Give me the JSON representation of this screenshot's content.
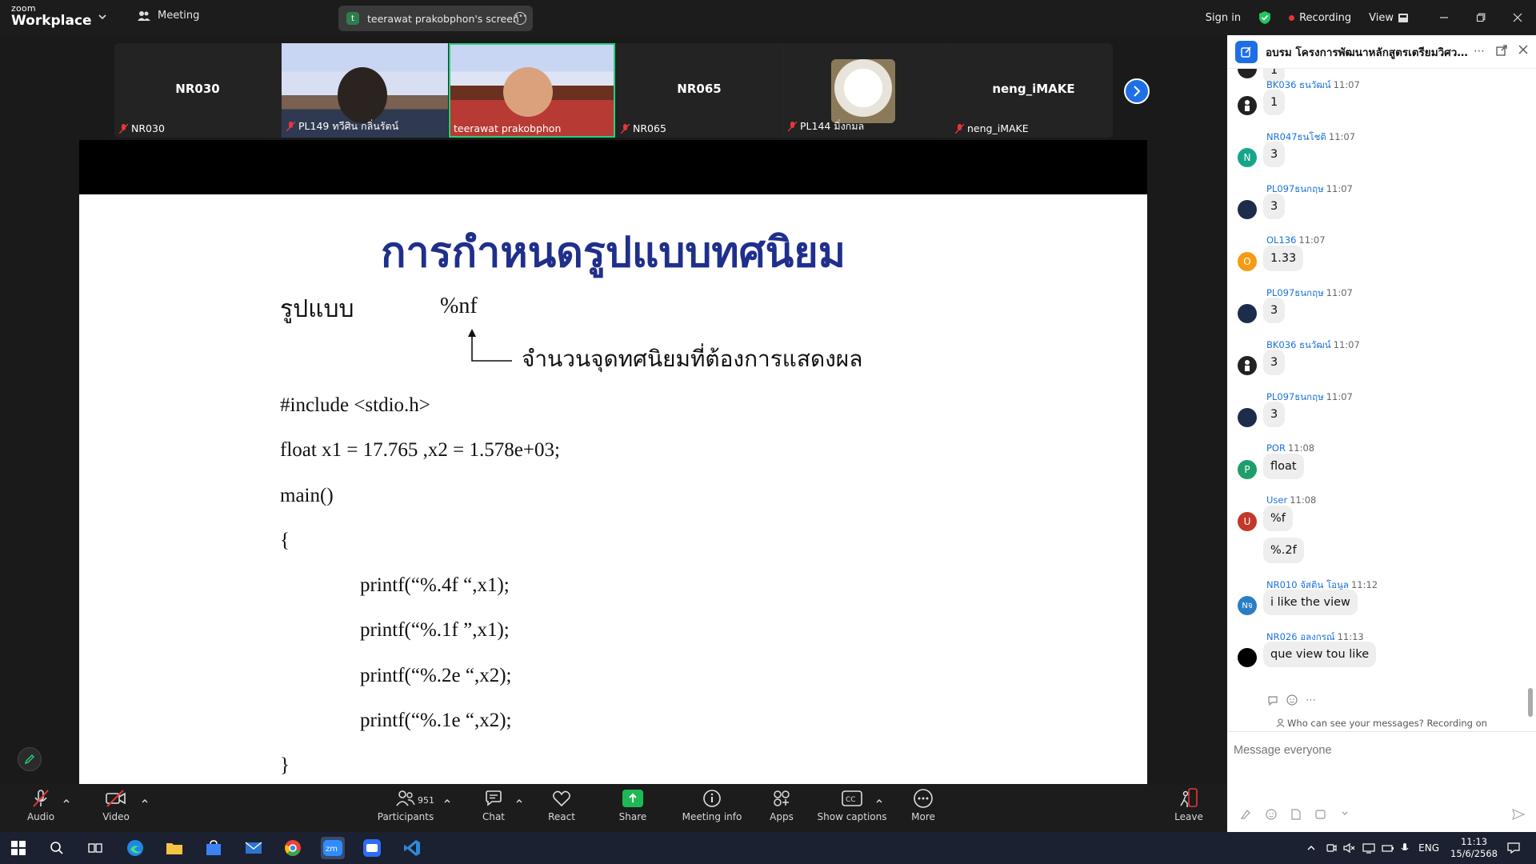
{
  "app": {
    "brand_small": "zoom",
    "brand_large": "Workplace",
    "meeting_label": "Meeting",
    "screen_tab_avatar": "t",
    "screen_tab_label": "teerawat prakobphon's screen",
    "sign_in": "Sign in",
    "recording": "Recording",
    "view": "View"
  },
  "gallery": {
    "tiles": [
      {
        "center": "NR030",
        "label": "NR030"
      },
      {
        "center": "",
        "label": "PL149 ทวีศิน กลิ่นรัตน์"
      },
      {
        "center": "",
        "label": "teerawat prakobphon"
      },
      {
        "center": "NR065",
        "label": "NR065"
      },
      {
        "center": "",
        "label": "PL144 มิ่งกมล"
      },
      {
        "center": "neng_iMAKE",
        "label": "neng_iMAKE"
      }
    ]
  },
  "slide": {
    "title": "การกำหนดรูปแบบทศนิยม",
    "format_label": "รูปแบบ",
    "format_spec": "%nf",
    "arrow_note": "จำนวนจุดทศนิยมที่ต้องการแสดงผล",
    "code": [
      "#include <stdio.h>",
      "float x1 = 17.765 ,x2 = 1.578e+03;",
      "main()",
      "{",
      "printf(“%.4f “,x1);",
      "printf(“%.1f ”,x1);",
      "printf(“%.2e “,x2);",
      "printf(“%.1e “,x2);",
      "}"
    ]
  },
  "toolbar": {
    "audio": "Audio",
    "video": "Video",
    "participants": "Participants",
    "participants_count": "951",
    "chat": "Chat",
    "react": "React",
    "share": "Share",
    "meeting_info": "Meeting info",
    "apps": "Apps",
    "captions": "Show captions",
    "more": "More",
    "leave": "Leave"
  },
  "chat": {
    "title": "อบรม โครงการพัฒนาหลักสูตรเตรียมวิศวก...",
    "first_bubble": "1",
    "messages": [
      {
        "sender": "BK036 ธนวัฒน์",
        "time": "11:07",
        "text": "1",
        "avatar": "",
        "color": "#222222"
      },
      {
        "sender": "NR047ธนโชติ",
        "time": "11:07",
        "text": "3",
        "avatar": "N",
        "color": "#17a589"
      },
      {
        "sender": "PL097ธนกฤษ",
        "time": "11:07",
        "text": "3",
        "avatar": "",
        "color": "#1d2b4d"
      },
      {
        "sender": "OL136",
        "time": "11:07",
        "text": "1.33",
        "avatar": "O",
        "color": "#f39c12"
      },
      {
        "sender": "PL097ธนกฤษ",
        "time": "11:07",
        "text": "3",
        "avatar": "",
        "color": "#1d2b4d"
      },
      {
        "sender": "BK036 ธนวัฒน์",
        "time": "11:07",
        "text": "3",
        "avatar": "",
        "color": "#222222"
      },
      {
        "sender": "PL097ธนกฤษ",
        "time": "11:07",
        "text": "3",
        "avatar": "",
        "color": "#1d2b4d"
      },
      {
        "sender": "POR",
        "time": "11:08",
        "text": "float",
        "avatar": "P",
        "color": "#1e9e6a"
      },
      {
        "sender": "User",
        "time": "11:08",
        "text": "%f",
        "avatar": "U",
        "color": "#c0392b"
      },
      {
        "sender": "",
        "time": "",
        "text": "%.2f",
        "avatar": "",
        "color": ""
      },
      {
        "sender": "NR010 จัสติน โอนูล",
        "time": "11:12",
        "text": "i like the view",
        "avatar": "Nจ",
        "color": "#2a7fc4"
      },
      {
        "sender": "NR026 อลงกรณ์",
        "time": "11:13",
        "text": "que view tou like",
        "avatar": "",
        "color": "#000000"
      }
    ],
    "visibility_note": "Who can see your messages? Recording on",
    "input_placeholder": "Message everyone"
  },
  "taskbar": {
    "lang": "ENG",
    "time": "11:13",
    "date": "15/6/2568"
  }
}
